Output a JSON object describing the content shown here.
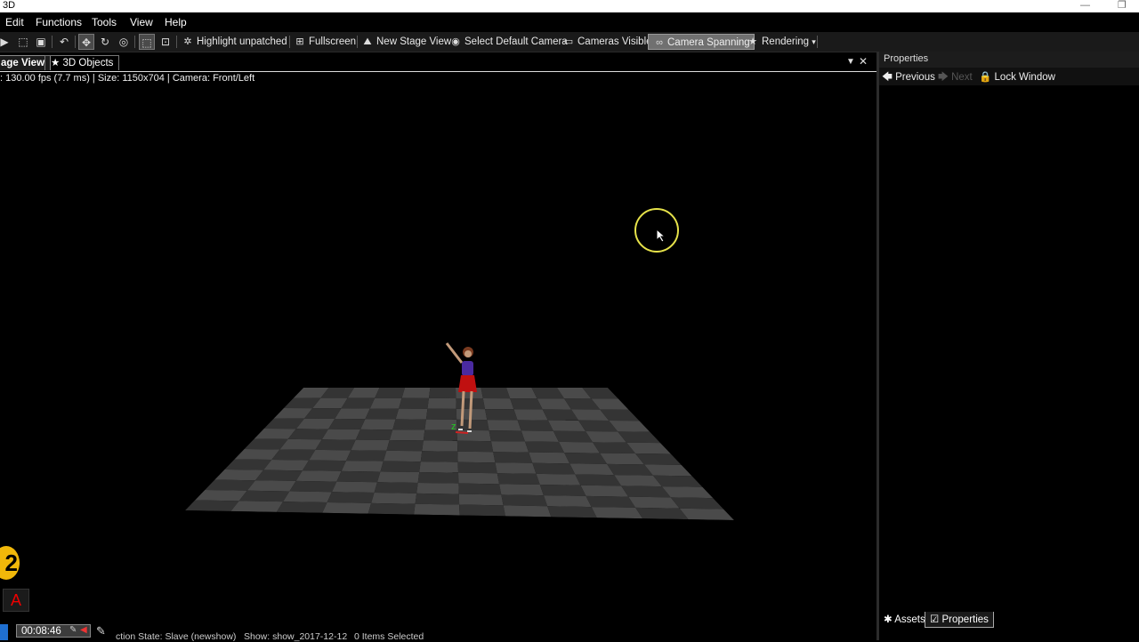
{
  "window": {
    "title": "3D"
  },
  "menu": {
    "items": [
      "Edit",
      "Functions",
      "Tools",
      "View",
      "Help"
    ]
  },
  "toolbar": {
    "icons": [
      "play-icon",
      "open-icon",
      "save-icon",
      "undo-icon",
      "move-icon",
      "rotate-icon",
      "target-icon",
      "select-icon",
      "zoom-icon"
    ],
    "buttons": {
      "highlight": "Highlight unpatched",
      "fullscreen": "Fullscreen",
      "new_stage": "New Stage View",
      "select_camera": "Select Default Camera",
      "cameras_visible": "Cameras Visible",
      "camera_spanning": "Camera Spanning",
      "rendering": "Rendering"
    }
  },
  "tabs": {
    "stage_view": "age View",
    "objects": "3D Objects"
  },
  "viewport": {
    "status": ": 130.00 fps (7.7 ms) | Size: 1150x704 | Camera: Front/Left",
    "floor_colors": {
      "light": "#4a4a4a",
      "dark": "#343434"
    },
    "figure_colors": {
      "top": "#4a2aa0",
      "skirt": "#c01010",
      "skin": "#c29a7a"
    }
  },
  "properties": {
    "header": "Properties",
    "previous": "Previous",
    "next": "Next",
    "lock": "Lock Window",
    "tabs": {
      "assets": "Assets",
      "properties": "Properties"
    }
  },
  "statusbar": {
    "connection": "ction State: Slave (newshow)",
    "show": "Show: show_2017-12-12",
    "selected": "0 Items Selected"
  },
  "timer": {
    "value": "00:08:46"
  },
  "badges": {
    "number": "2",
    "letter": "A"
  },
  "accent": {
    "cursor_ring": "#e6e24a",
    "badge": "#f1b80a",
    "active_button": "#707070"
  }
}
